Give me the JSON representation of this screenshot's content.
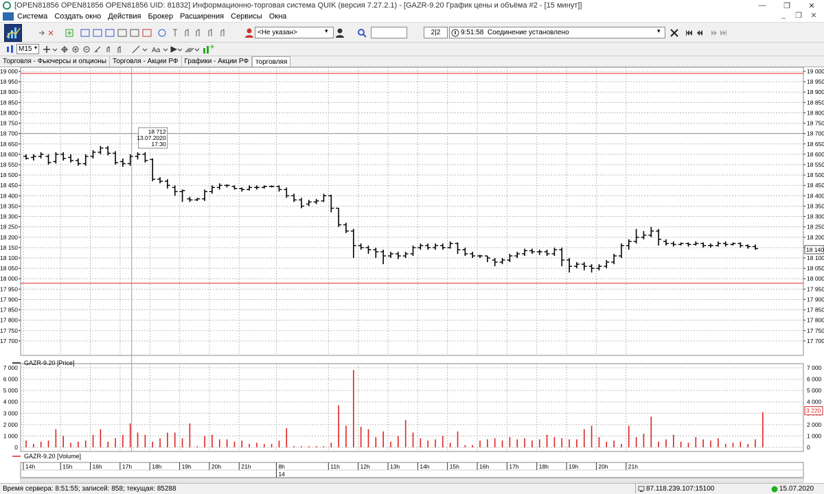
{
  "window": {
    "title": "[OPEN81856 OPEN81856 OPEN81856 UID: 81832] Информационно-торговая система QUIK (версия 7.27.2.1) - [GAZR-9.20 График цены и объёма #2 - [15 минут]]",
    "controls": [
      "—",
      "❐",
      "✕"
    ]
  },
  "menu": {
    "items": [
      "Система",
      "Создать окно",
      "Действия",
      "Брокер",
      "Расширения",
      "Сервисы",
      "Окна"
    ],
    "mdi_controls": [
      "_",
      "❐",
      "✕"
    ]
  },
  "toolbar": {
    "account_select": "<Не указан>",
    "search_value": "",
    "page_indicator": "2|2",
    "connection_time": "9:51:58",
    "connection_status": "Соединение установлено",
    "interval": "M15",
    "text_tool": "Aa"
  },
  "tabs": [
    {
      "label": "Торговля - Фьючерсы и опционы",
      "active": false
    },
    {
      "label": "Торговля - Акции РФ",
      "active": false
    },
    {
      "label": "Графики - Акции РФ",
      "active": false
    },
    {
      "label": "торговляя",
      "active": true
    }
  ],
  "chart_data": {
    "type": "candlestick",
    "instrument": "GAZR-9.20",
    "price_panel": {
      "legend": "GAZR-9.20 [Price]",
      "ylim": [
        17650,
        19000
      ],
      "ticks": [
        19000,
        18950,
        18900,
        18850,
        18800,
        18750,
        18700,
        18650,
        18600,
        18550,
        18500,
        18450,
        18400,
        18350,
        18300,
        18250,
        18200,
        18150,
        18100,
        18050,
        18000,
        17950,
        17900,
        17850,
        17800,
        17750,
        17700
      ],
      "tick_labels": [
        "19 000",
        "18 950",
        "18 900",
        "18 850",
        "18 800",
        "18 750",
        "18 700",
        "18 650",
        "18 600",
        "18 550",
        "18 500",
        "18 450",
        "18 400",
        "18 350",
        "18 300",
        "18 250",
        "18 200",
        "18 150",
        "18 100",
        "18 050",
        "18 000",
        "17 950",
        "17 900",
        "17 850",
        "17 800",
        "17 750",
        "17 700"
      ],
      "h_lines": [
        {
          "value": 18990,
          "color": "#e02020"
        },
        {
          "value": 17978,
          "color": "#e02020"
        }
      ],
      "last_price_label": "18 140",
      "last_price": 18140,
      "crosshair_tooltip": {
        "price": "18 712",
        "date": "13.07.2020",
        "time": "17:30",
        "price_value": 18712
      },
      "bars": [
        [
          18590,
          18580,
          18600,
          18575
        ],
        [
          18585,
          18590,
          18600,
          18570
        ],
        [
          18590,
          18600,
          18610,
          18580
        ],
        [
          18590,
          18560,
          18600,
          18550
        ],
        [
          18565,
          18600,
          18610,
          18555
        ],
        [
          18600,
          18580,
          18610,
          18570
        ],
        [
          18585,
          18570,
          18600,
          18560
        ],
        [
          18570,
          18555,
          18580,
          18545
        ],
        [
          18555,
          18590,
          18600,
          18545
        ],
        [
          18590,
          18610,
          18620,
          18580
        ],
        [
          18610,
          18630,
          18640,
          18600
        ],
        [
          18630,
          18605,
          18640,
          18595
        ],
        [
          18605,
          18560,
          18615,
          18550
        ],
        [
          18565,
          18555,
          18580,
          18540
        ],
        [
          18555,
          18590,
          18600,
          18545
        ],
        [
          18590,
          18600,
          18610,
          18575
        ],
        [
          18600,
          18570,
          18610,
          18560
        ],
        [
          18575,
          18480,
          18580,
          18470
        ],
        [
          18480,
          18470,
          18490,
          18460
        ],
        [
          18470,
          18450,
          18480,
          18435
        ],
        [
          18440,
          18420,
          18450,
          18400
        ],
        [
          18420,
          18425,
          18430,
          18370
        ],
        [
          18385,
          18380,
          18395,
          18370
        ],
        [
          18380,
          18385,
          18390,
          18375
        ],
        [
          18385,
          18420,
          18430,
          18375
        ],
        [
          18420,
          18440,
          18450,
          18410
        ],
        [
          18440,
          18450,
          18460,
          18430
        ],
        [
          18450,
          18450,
          18455,
          18440
        ],
        [
          18445,
          18435,
          18450,
          18430
        ],
        [
          18435,
          18430,
          18440,
          18420
        ],
        [
          18430,
          18440,
          18450,
          18425
        ],
        [
          18440,
          18440,
          18450,
          18430
        ],
        [
          18440,
          18445,
          18450,
          18435
        ],
        [
          18445,
          18445,
          18450,
          18440
        ],
        [
          18445,
          18430,
          18450,
          18420
        ],
        [
          18430,
          18400,
          18440,
          18390
        ],
        [
          18400,
          18380,
          18410,
          18370
        ],
        [
          18380,
          18350,
          18390,
          18340
        ],
        [
          18360,
          18370,
          18380,
          18350
        ],
        [
          18370,
          18375,
          18385,
          18360
        ],
        [
          18375,
          18400,
          18410,
          18370
        ],
        [
          18400,
          18340,
          18405,
          18320
        ],
        [
          18340,
          18260,
          18340,
          18250
        ],
        [
          18260,
          18230,
          18270,
          18220
        ],
        [
          18230,
          18160,
          18240,
          18100
        ],
        [
          18160,
          18150,
          18170,
          18140
        ],
        [
          18150,
          18140,
          18160,
          18120
        ],
        [
          18140,
          18130,
          18150,
          18100
        ],
        [
          18130,
          18110,
          18140,
          18070
        ],
        [
          18110,
          18120,
          18130,
          18100
        ],
        [
          18120,
          18110,
          18130,
          18095
        ],
        [
          18110,
          18120,
          18130,
          18100
        ],
        [
          18120,
          18150,
          18160,
          18110
        ],
        [
          18150,
          18160,
          18170,
          18140
        ],
        [
          18160,
          18150,
          18170,
          18140
        ],
        [
          18150,
          18160,
          18170,
          18140
        ],
        [
          18160,
          18150,
          18170,
          18140
        ],
        [
          18150,
          18170,
          18180,
          18145
        ],
        [
          18170,
          18140,
          18175,
          18120
        ],
        [
          18140,
          18120,
          18150,
          18110
        ],
        [
          18120,
          18110,
          18130,
          18100
        ],
        [
          18110,
          18110,
          18115,
          18100
        ],
        [
          18110,
          18100,
          18110,
          18080
        ],
        [
          18090,
          18080,
          18100,
          18060
        ],
        [
          18080,
          18090,
          18100,
          18070
        ],
        [
          18090,
          18110,
          18120,
          18080
        ],
        [
          18110,
          18120,
          18130,
          18100
        ],
        [
          18120,
          18135,
          18145,
          18110
        ],
        [
          18135,
          18130,
          18145,
          18120
        ],
        [
          18130,
          18130,
          18140,
          18115
        ],
        [
          18130,
          18120,
          18140,
          18110
        ],
        [
          18120,
          18140,
          18150,
          18110
        ],
        [
          18140,
          18090,
          18150,
          18060
        ],
        [
          18090,
          18060,
          18100,
          18030
        ],
        [
          18060,
          18070,
          18080,
          18050
        ],
        [
          18070,
          18060,
          18080,
          18040
        ],
        [
          18060,
          18050,
          18070,
          18030
        ],
        [
          18050,
          18060,
          18070,
          18040
        ],
        [
          18060,
          18080,
          18090,
          18050
        ],
        [
          18080,
          18110,
          18120,
          18070
        ],
        [
          18110,
          18160,
          18170,
          18100
        ],
        [
          18160,
          18180,
          18190,
          18140
        ],
        [
          18180,
          18200,
          18240,
          18170
        ],
        [
          18200,
          18210,
          18230,
          18190
        ],
        [
          18210,
          18230,
          18250,
          18200
        ],
        [
          18230,
          18190,
          18240,
          18160
        ],
        [
          18180,
          18170,
          18190,
          18160
        ],
        [
          18170,
          18165,
          18180,
          18155
        ],
        [
          18165,
          18170,
          18175,
          18160
        ],
        [
          18170,
          18165,
          18175,
          18155
        ],
        [
          18165,
          18170,
          18180,
          18160
        ],
        [
          18170,
          18160,
          18175,
          18150
        ],
        [
          18160,
          18160,
          18170,
          18150
        ],
        [
          18160,
          18170,
          18180,
          18155
        ],
        [
          18170,
          18165,
          18180,
          18155
        ],
        [
          18165,
          18170,
          18175,
          18160
        ],
        [
          18170,
          18160,
          18175,
          18150
        ],
        [
          18160,
          18155,
          18165,
          18145
        ],
        [
          18155,
          18145,
          18165,
          18140
        ]
      ]
    },
    "volume_panel": {
      "legend": "GAZR-9.20 [Volume]",
      "ylim": [
        0,
        7000
      ],
      "ticks": [
        7000,
        6000,
        5000,
        4000,
        3000,
        2000,
        1000,
        0
      ],
      "tick_labels": [
        "7 000",
        "6 000",
        "5 000",
        "4 000",
        "3 000",
        "2 000",
        "1 000",
        "0"
      ],
      "last_volume_label": "3 220",
      "last_volume": 3220,
      "bar_color": "#e02020",
      "values": [
        600,
        300,
        500,
        600,
        1600,
        1000,
        400,
        500,
        600,
        1100,
        1600,
        500,
        800,
        1100,
        2100,
        1300,
        1100,
        500,
        800,
        1300,
        1300,
        800,
        2100,
        100,
        1000,
        1100,
        700,
        700,
        500,
        600,
        300,
        400,
        300,
        300,
        600,
        1700,
        100,
        100,
        100,
        100,
        100,
        400,
        3700,
        1900,
        6800,
        1800,
        1600,
        900,
        1400,
        500,
        1000,
        2400,
        1300,
        800,
        600,
        700,
        1000,
        400,
        1400,
        200,
        200,
        600,
        700,
        800,
        600,
        900,
        700,
        800,
        600,
        700,
        1100,
        900,
        800,
        700,
        700,
        1600,
        1900,
        900,
        500,
        600,
        300,
        1900,
        900,
        1200,
        2700,
        500,
        700,
        1100,
        500,
        400,
        900,
        700,
        600,
        800,
        300,
        400,
        500,
        300,
        700,
        3100
      ],
      "legend_color": "#e02020"
    },
    "x_axis": {
      "labels": [
        "14h",
        "15h",
        "16h",
        "17h",
        "18h",
        "19h",
        "20h",
        "21h",
        "8h",
        "11h",
        "12h",
        "13h",
        "14h",
        "15h",
        "16h",
        "17h",
        "18h",
        "19h",
        "20h",
        "21h"
      ],
      "label_bar_index": [
        0,
        5,
        9,
        13,
        17,
        21,
        25,
        29,
        34,
        41,
        45,
        49,
        53,
        57,
        61,
        65,
        69,
        73,
        77,
        81
      ],
      "day_label": "14",
      "day_label_bar_index": 34
    },
    "crosshair_bar_index": 14
  },
  "status": {
    "server_time": "Время сервера: 8:51:55; записей: 858; текущая: 85288",
    "ip": "87.118.239.107:15100",
    "date": "15.07.2020",
    "status_color": "#20b020"
  }
}
